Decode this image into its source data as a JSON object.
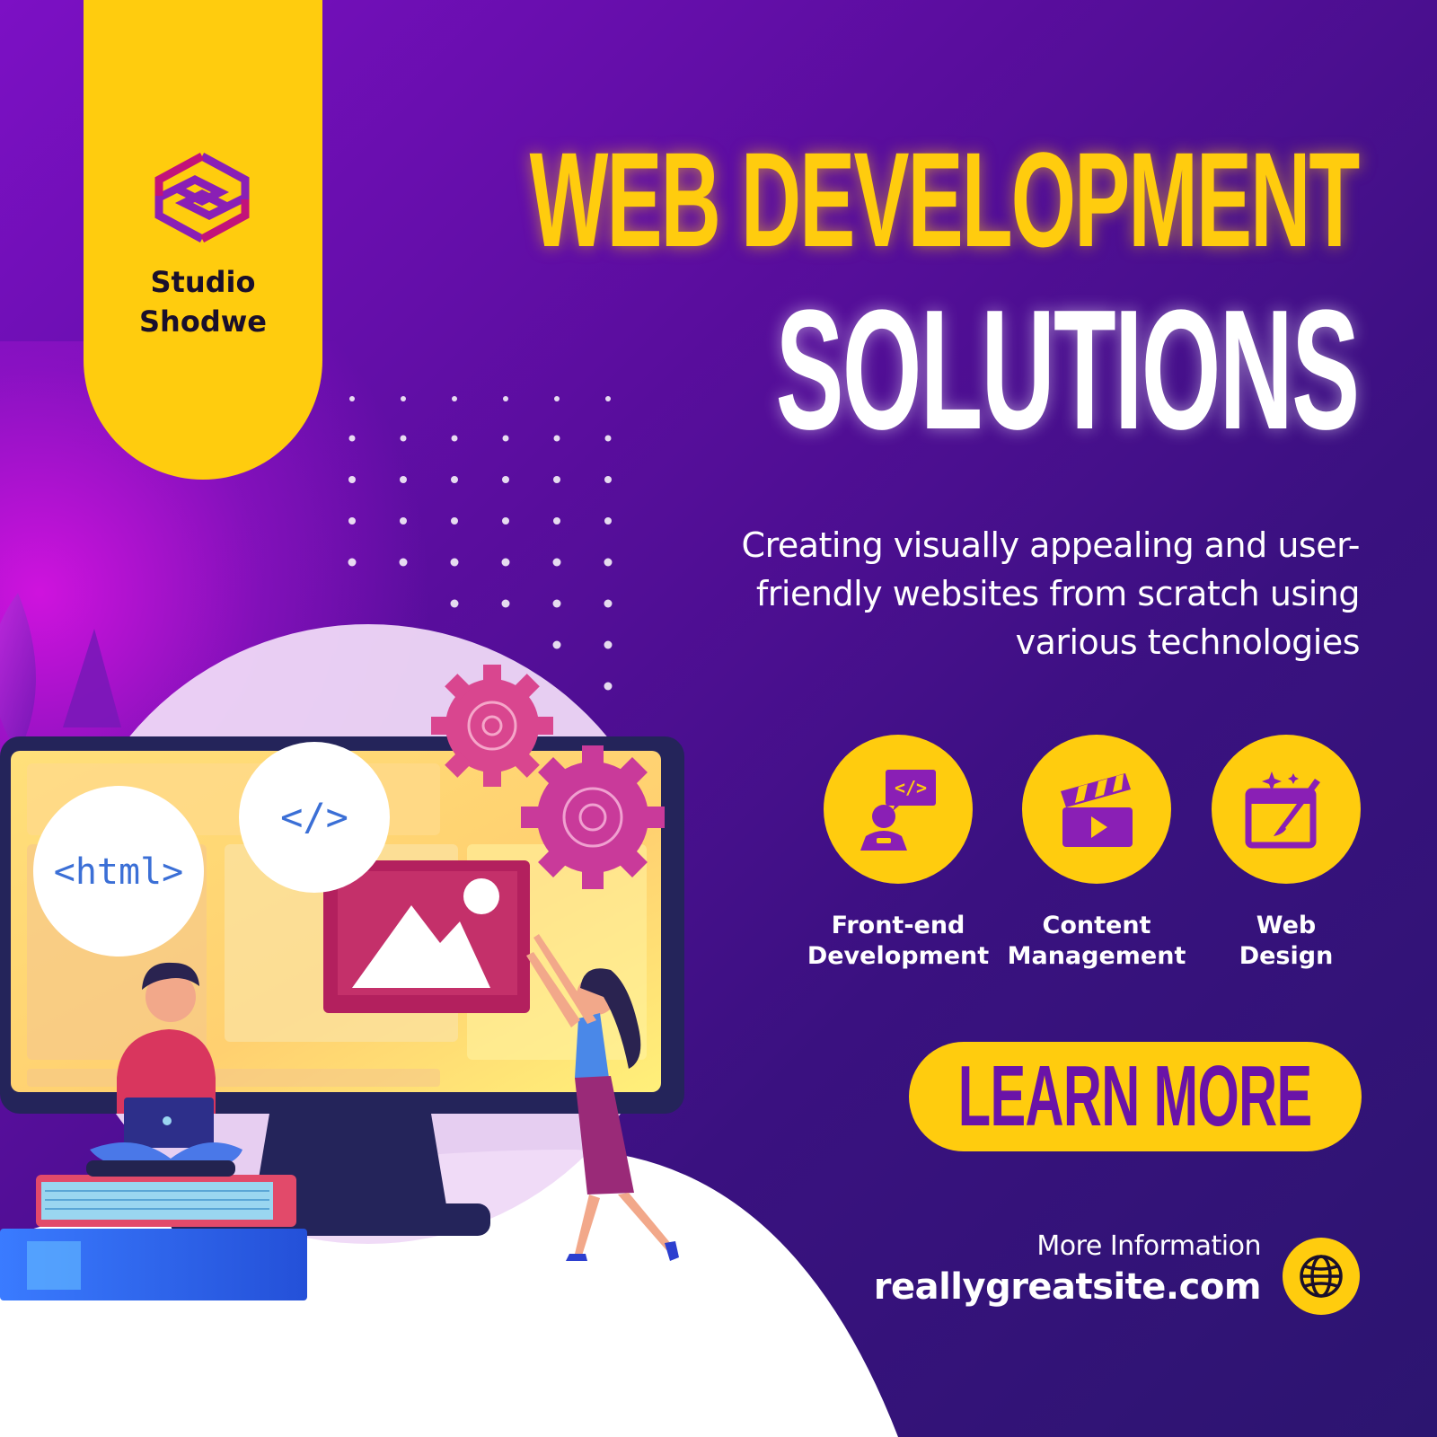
{
  "brand": {
    "name": "Studio\nShodwe",
    "logo_icon": "hexagon-s-logo-icon"
  },
  "headline": {
    "line1": "WEB DEVELOPMENT",
    "line2": "SOLUTIONS"
  },
  "subtitle": "Creating visually appealing and user-friendly websites from scratch using various technologies",
  "services": [
    {
      "label": "Front-end\nDevelopment",
      "icon": "code-developer-icon"
    },
    {
      "label": "Content\nManagement",
      "icon": "clapperboard-play-icon"
    },
    {
      "label": "Web\nDesign",
      "icon": "browser-paintbrush-icon"
    }
  ],
  "cta": {
    "label": "LEARN MORE"
  },
  "contact": {
    "label": "More Information",
    "url": "reallygreatsite.com",
    "icon": "globe-icon"
  },
  "illustration": {
    "html_bubble": "<html>",
    "code_bubble": "</>"
  },
  "colors": {
    "accent": "#ffcc0e",
    "purple": "#6a13a8",
    "background": "#3a1180"
  }
}
